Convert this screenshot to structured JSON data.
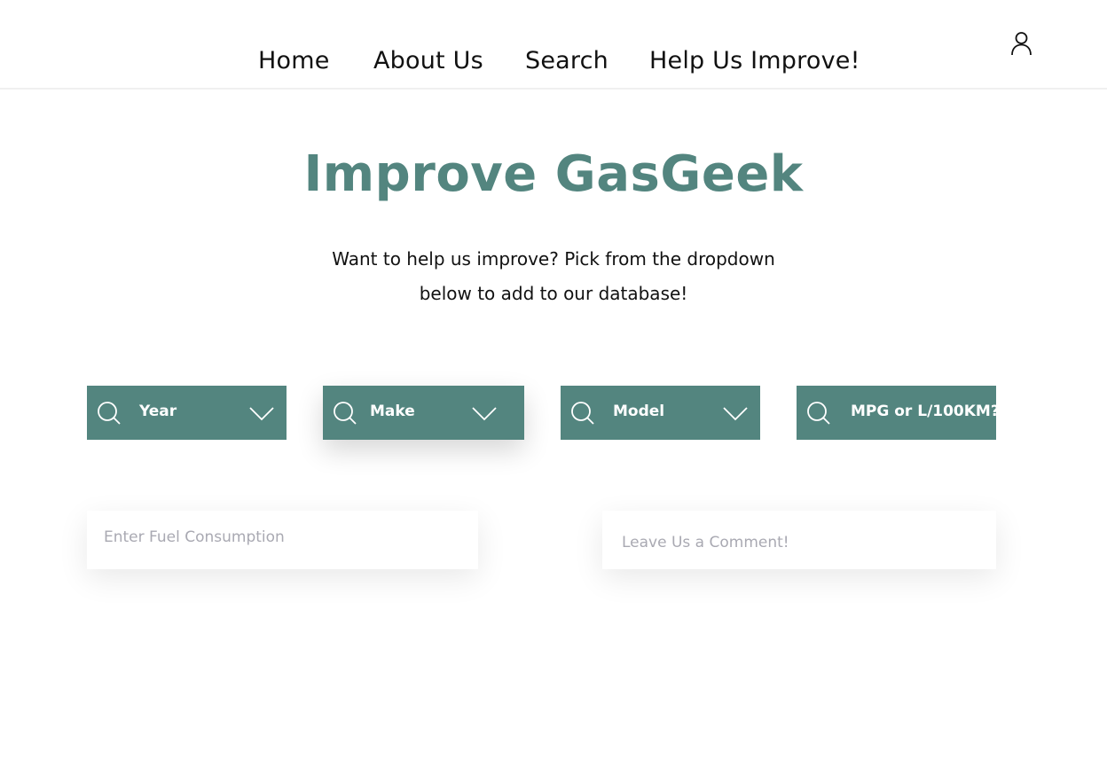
{
  "nav": {
    "items": [
      {
        "label": "Home"
      },
      {
        "label": "About Us"
      },
      {
        "label": "Search"
      },
      {
        "label": "Help Us Improve!"
      }
    ],
    "account_icon": "user-icon"
  },
  "main": {
    "title": "Improve GasGeek",
    "intro_line1": "Want to help us improve? Pick from the dropdown",
    "intro_line2": "below to add to our database!"
  },
  "dropdowns": [
    {
      "label": "Year",
      "icon": "search-icon"
    },
    {
      "label": "Make",
      "icon": "search-icon"
    },
    {
      "label": "Model",
      "icon": "search-icon"
    },
    {
      "label": "MPG or L/100KM?",
      "icon": "search-icon"
    }
  ],
  "inputs": {
    "fuel": {
      "placeholder": "Enter Fuel Consumption",
      "value": ""
    },
    "comment": {
      "placeholder": "Leave Us a Comment!",
      "value": ""
    }
  },
  "colors": {
    "accent": "#53857f",
    "text": "#111111",
    "placeholder": "#a9a9b2",
    "background": "#ffffff"
  }
}
